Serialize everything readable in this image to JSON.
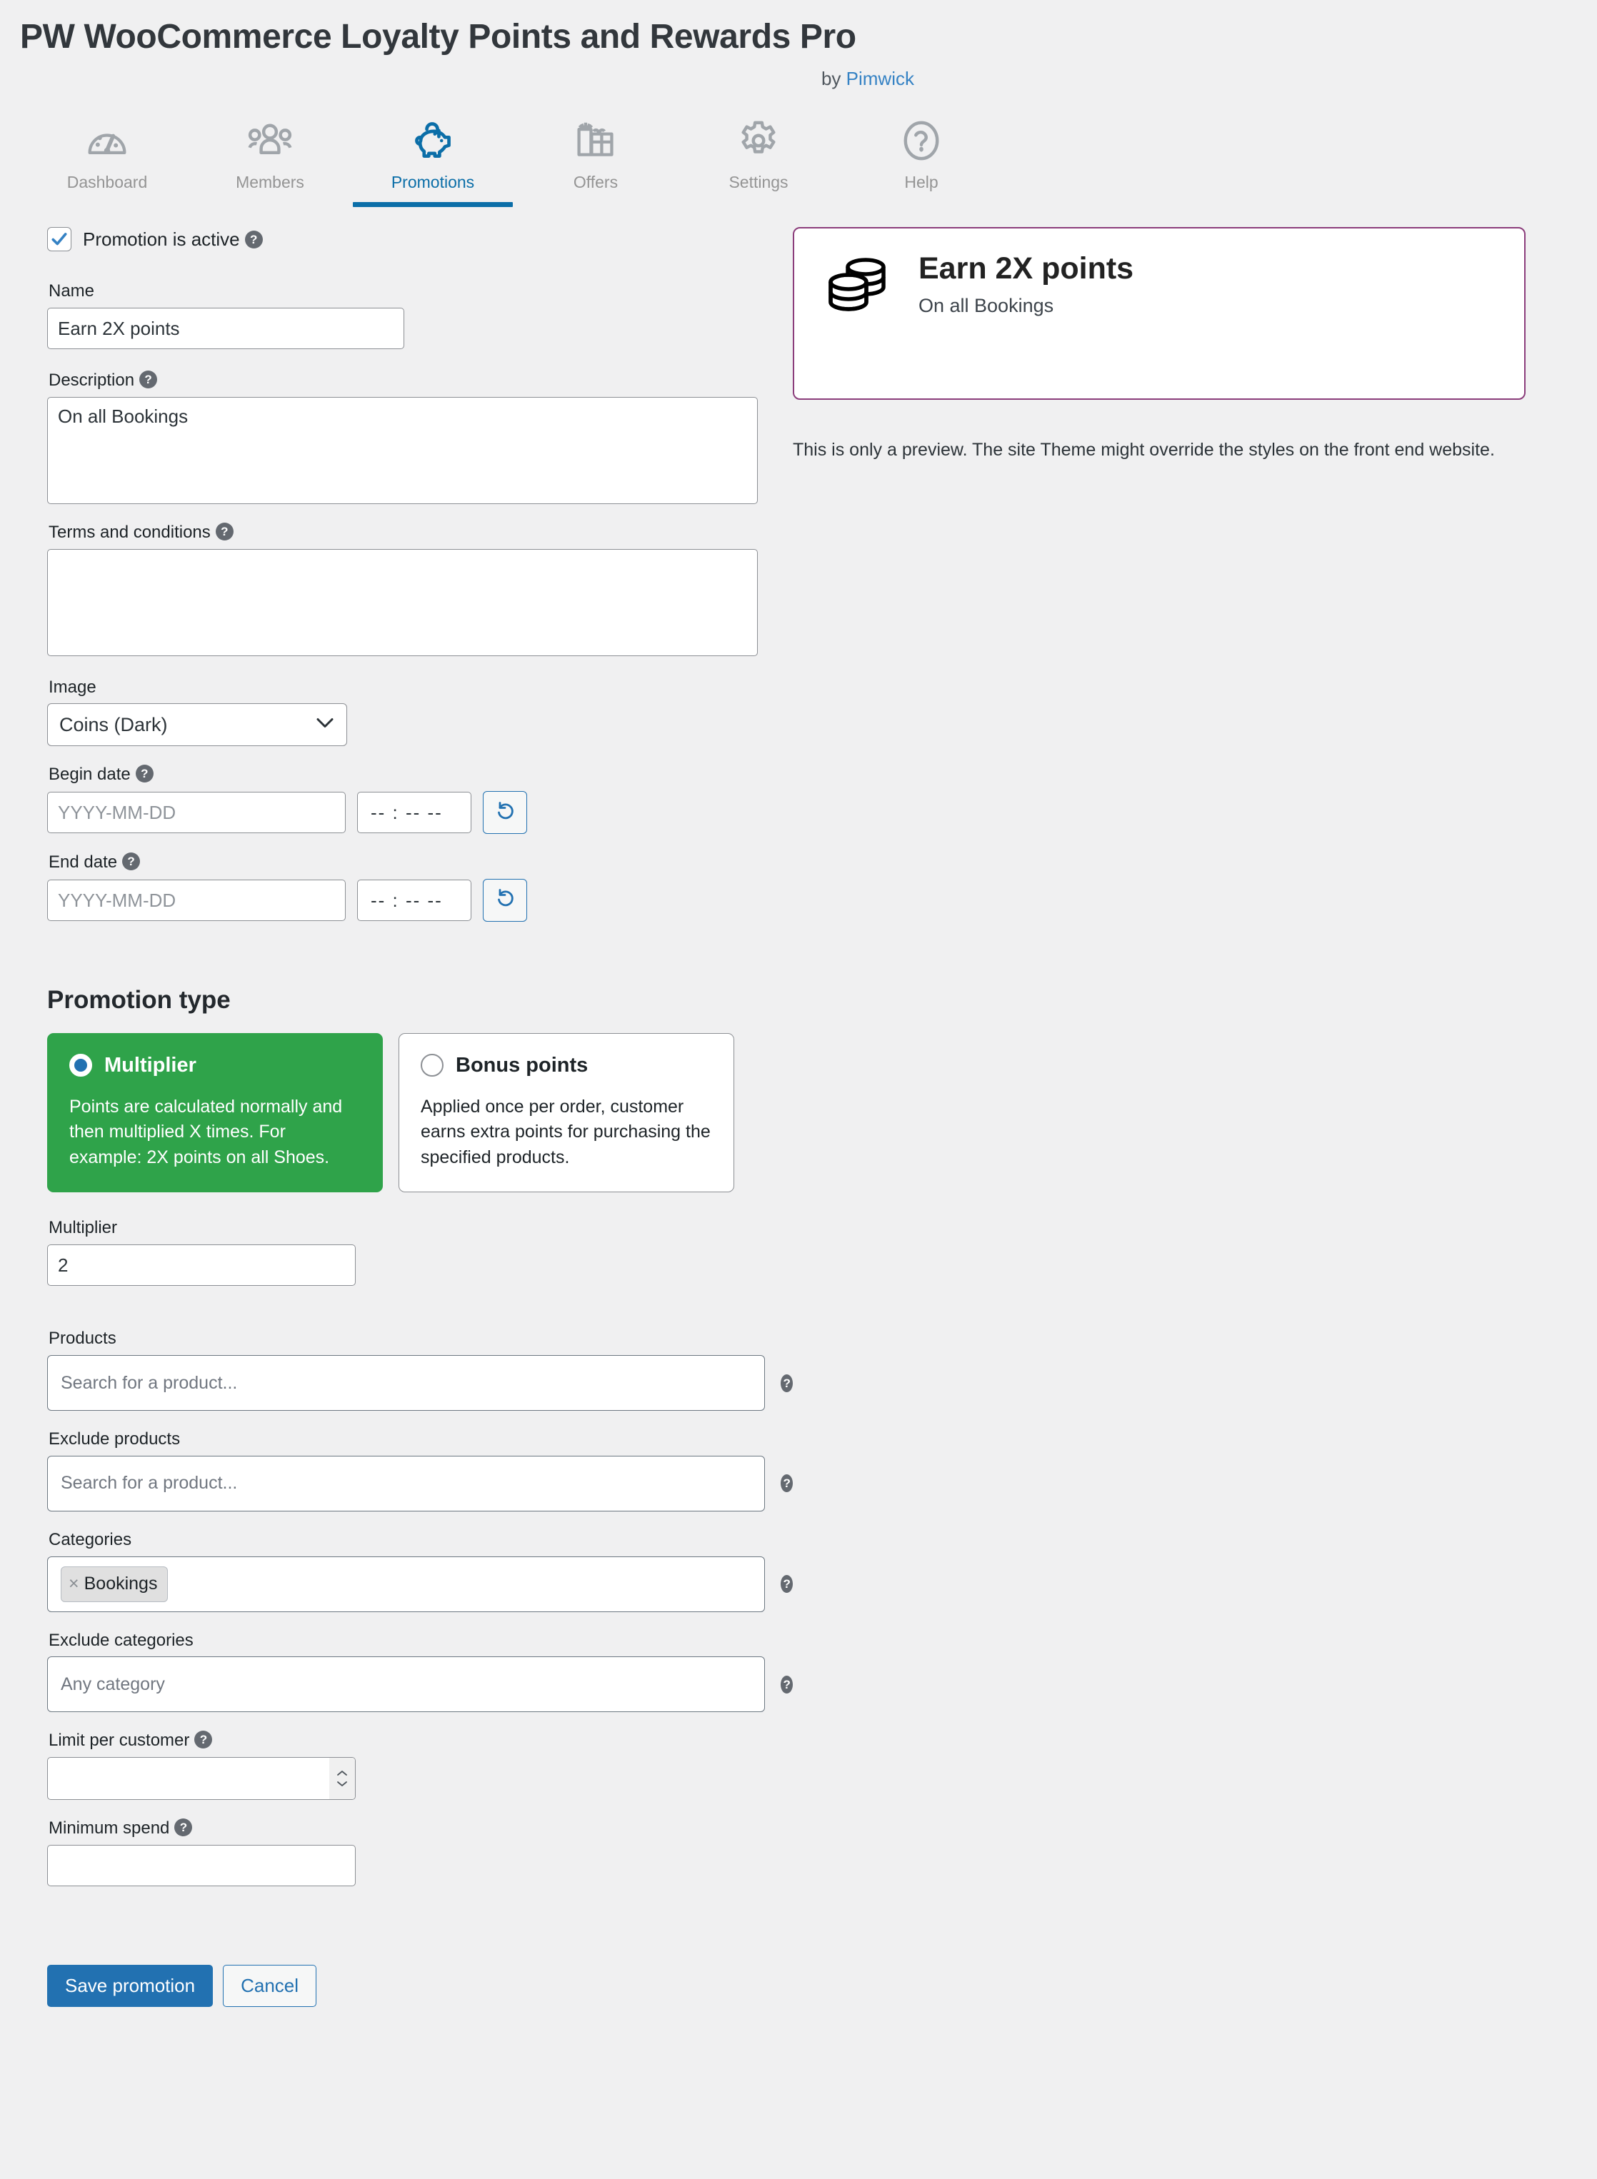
{
  "header": {
    "title": "PW WooCommerce Loyalty Points and Rewards Pro",
    "by_prefix": "by ",
    "by_link": "Pimwick"
  },
  "tabs": [
    {
      "label": "Dashboard",
      "icon": "gauge-icon",
      "active": false
    },
    {
      "label": "Members",
      "icon": "people-icon",
      "active": false
    },
    {
      "label": "Promotions",
      "icon": "piggy-bank-icon",
      "active": true
    },
    {
      "label": "Offers",
      "icon": "gift-icon",
      "active": false
    },
    {
      "label": "Settings",
      "icon": "gear-icon",
      "active": false
    },
    {
      "label": "Help",
      "icon": "question-circle-icon",
      "active": false
    }
  ],
  "form": {
    "active_checkbox_label": "Promotion is active",
    "name_label": "Name",
    "name_value": "Earn 2X points",
    "description_label": "Description",
    "description_value": "On all Bookings",
    "terms_label": "Terms and conditions",
    "terms_value": "",
    "image_label": "Image",
    "image_value": "Coins (Dark)",
    "begin_date_label": "Begin date",
    "begin_date_placeholder": "YYYY-MM-DD",
    "begin_date_value": "",
    "begin_time_value": "-- : --  --",
    "end_date_label": "End date",
    "end_date_placeholder": "YYYY-MM-DD",
    "end_date_value": "",
    "end_time_value": "-- : --  --",
    "reset_icon": "reset-arrow-icon",
    "help_glyph": "?"
  },
  "promotion_type": {
    "section_title": "Promotion type",
    "options": [
      {
        "title": "Multiplier",
        "description": "Points are calculated normally and then multiplied X times. For example: 2X points on all Shoes.",
        "selected": true
      },
      {
        "title": "Bonus points",
        "description": "Applied once per order, customer earns extra points for purchasing the specified products.",
        "selected": false
      }
    ],
    "multiplier_label": "Multiplier",
    "multiplier_value": "2"
  },
  "targeting": {
    "products_label": "Products",
    "products_placeholder": "Search for a product...",
    "products_value": "",
    "exclude_products_label": "Exclude products",
    "exclude_products_placeholder": "Search for a product...",
    "exclude_products_value": "",
    "categories_label": "Categories",
    "categories_tokens": [
      "Bookings"
    ],
    "token_remove_glyph": "×",
    "exclude_categories_label": "Exclude categories",
    "exclude_categories_placeholder": "Any category",
    "exclude_categories_value": "",
    "limit_per_customer_label": "Limit per customer",
    "limit_per_customer_value": "",
    "minimum_spend_label": "Minimum spend",
    "minimum_spend_value": ""
  },
  "actions": {
    "save_label": "Save promotion",
    "cancel_label": "Cancel"
  },
  "preview": {
    "title": "Earn 2X points",
    "subtitle": "On all Bookings",
    "icon": "coins-stack-icon",
    "note": "This is only a preview. The site Theme might override the styles on the front end website."
  },
  "colors": {
    "accent_blue": "#2271b1",
    "tab_active_blue": "#0b6ea8",
    "selected_green": "#2fa34a",
    "preview_border_purple": "#8b3d7b",
    "page_background": "#f0f0f1",
    "muted_gray": "#949494"
  }
}
